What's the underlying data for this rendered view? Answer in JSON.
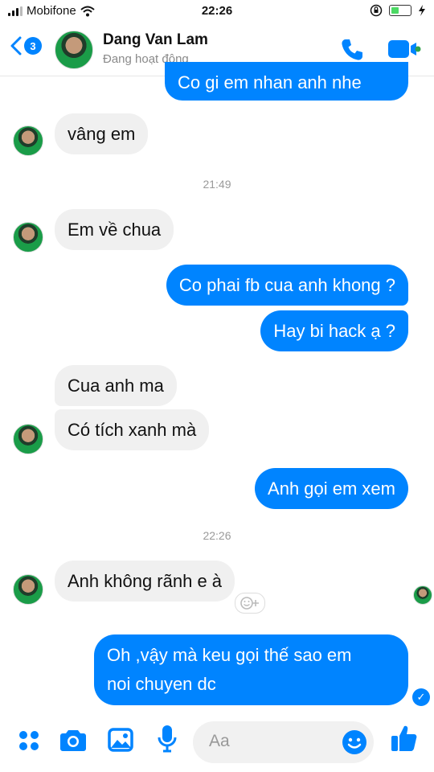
{
  "status_bar": {
    "carrier": "Mobifone",
    "time": "22:26"
  },
  "header": {
    "back_count": "3",
    "name": "Dang Van Lam",
    "status": "Đang hoạt động"
  },
  "messages": {
    "m1": "Co gi em nhan anh nhe",
    "m2": "vâng em",
    "t1": "21:49",
    "m3": "Em về chua",
    "m4": "Co phai fb cua anh khong ?",
    "m5": "Hay bi hack ạ ?",
    "m6": "Cua anh ma",
    "m7": "Có tích xanh mà",
    "m8": "Anh gọi em xem",
    "t2": "22:26",
    "m9": "Anh không rãnh e à",
    "m10_line1": "Oh ,vậy mà keu gọi thế sao em",
    "m10_line2": "noi chuyen dc"
  },
  "composer": {
    "placeholder": "Aa"
  },
  "colors": {
    "accent": "#0084ff",
    "incoming_bubble": "#f0f0f0"
  },
  "icons": [
    "back-chevron-icon",
    "phone-icon",
    "video-icon",
    "apps-icon",
    "camera-icon",
    "image-icon",
    "microphone-icon",
    "emoji-icon",
    "like-icon"
  ]
}
